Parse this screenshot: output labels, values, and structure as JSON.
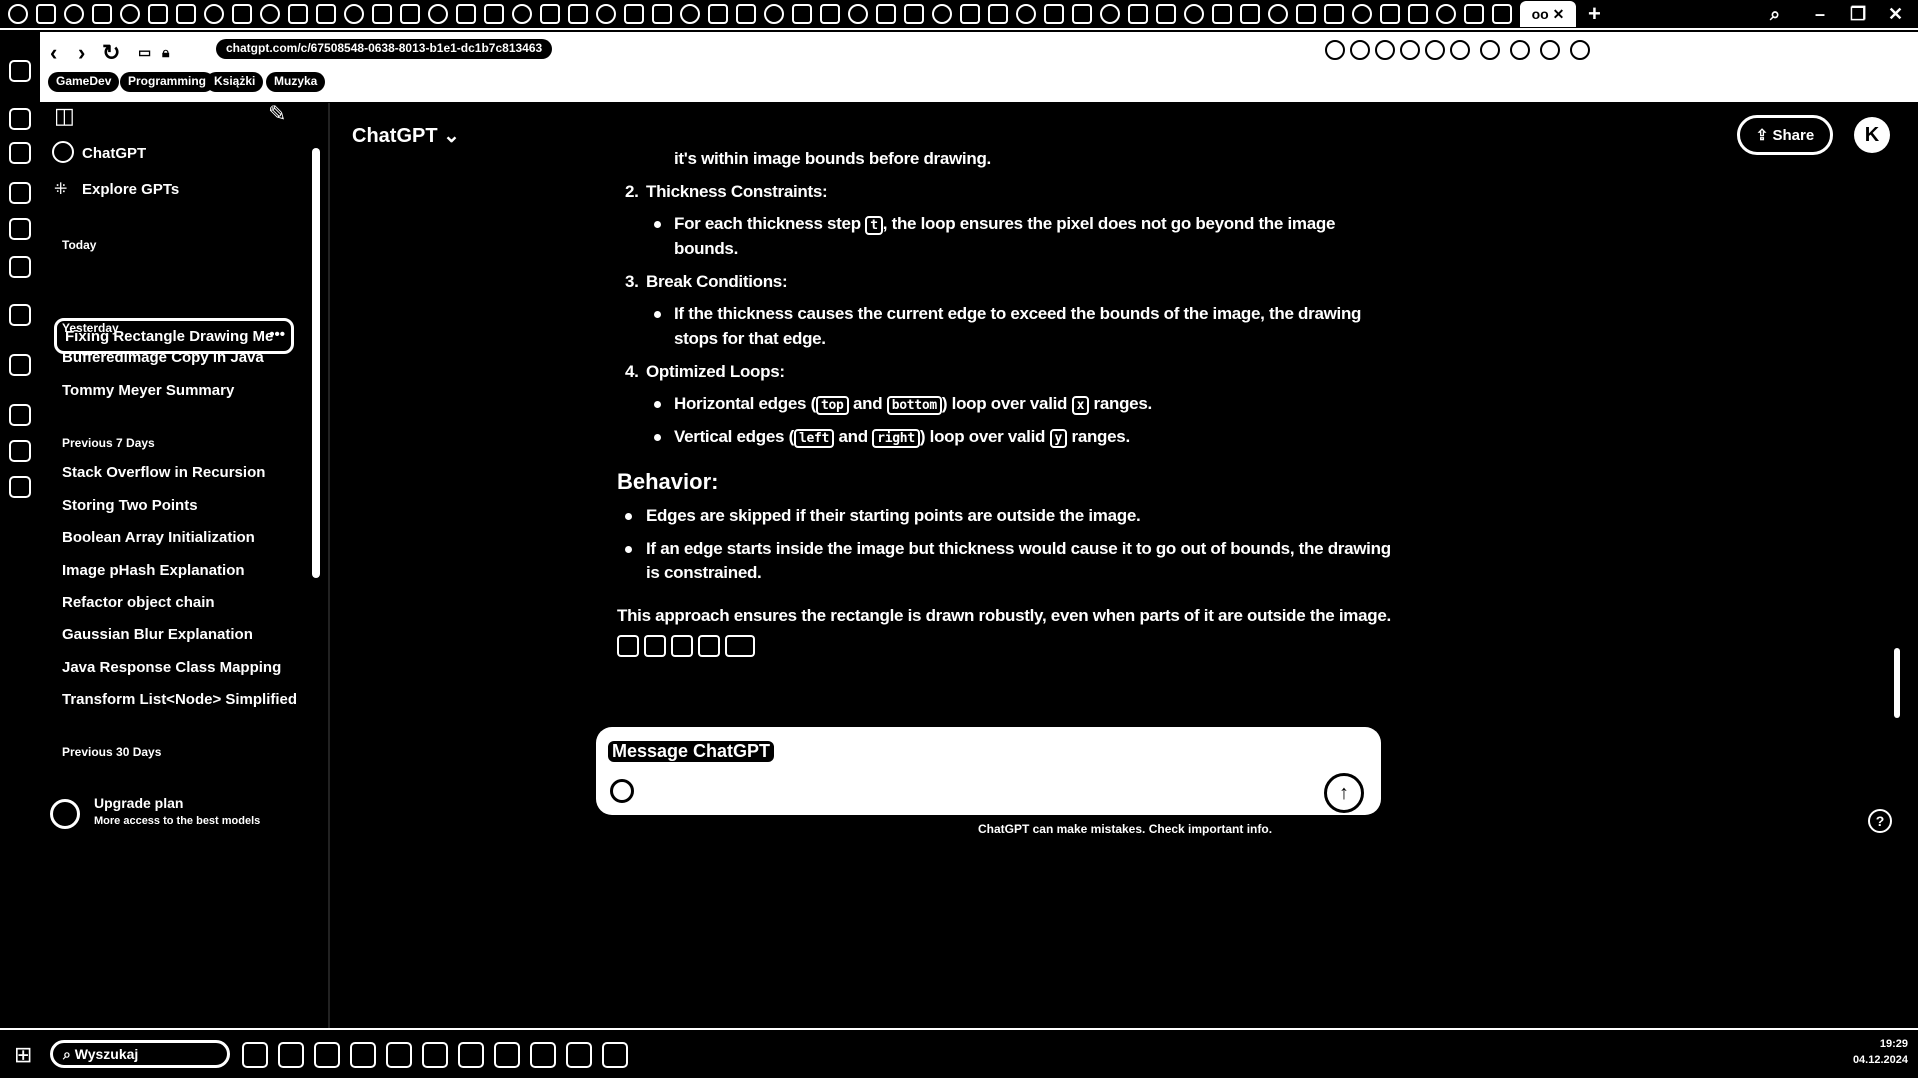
{
  "browser": {
    "active_tab_label": "oo",
    "url": "chatgpt.com/c/67508548-0638-8013-b1e1-dc1b7c813463",
    "bookmarks": [
      "GameDev",
      "Programming",
      "Książki",
      "Muzyka"
    ]
  },
  "sidebar": {
    "items": [
      {
        "label": "ChatGPT"
      },
      {
        "label": "Explore GPTs"
      }
    ],
    "sections": [
      {
        "title": "Today",
        "chats": [
          "Fixing Rectangle Drawing Me"
        ]
      },
      {
        "title": "Yesterday",
        "chats": [
          "BufferedImage Copy in Java",
          "Tommy Meyer Summary"
        ]
      },
      {
        "title": "Previous 7 Days",
        "chats": [
          "Stack Overflow in Recursion",
          "Storing Two Points",
          "Boolean Array Initialization",
          "Image pHash Explanation",
          "Refactor object chain",
          "Gaussian Blur Explanation",
          "Java Response Class Mapping",
          "Transform List<Node> Simplified"
        ]
      },
      {
        "title": "Previous 30 Days",
        "chats": []
      }
    ],
    "upgrade": {
      "title": "Upgrade plan",
      "subtitle": "More access to the best models"
    }
  },
  "header": {
    "model": "ChatGPT",
    "share": "Share",
    "avatar": "K"
  },
  "content": {
    "top_line": "it's within image bounds before drawing.",
    "items": [
      {
        "num": "2.",
        "title": "Thickness Constraints:"
      },
      {
        "num": "3.",
        "title": "Break Conditions:"
      },
      {
        "num": "4.",
        "title": "Optimized Loops:"
      }
    ],
    "b2a": "For each thickness step ",
    "b2code": "t",
    "b2b": ", the loop ensures the pixel does not go beyond the image",
    "b2c": "bounds.",
    "b3a": "If the thickness causes the current edge to exceed the bounds of the image, the drawing",
    "b3b": "stops for that edge.",
    "b4h": {
      "a": "Horizontal edges (",
      "c1": "top",
      "b": " and ",
      "c2": "bottom",
      "c": ") loop over valid ",
      "c3": "x",
      "d": " ranges."
    },
    "b4v": {
      "a": "Vertical edges (",
      "c1": "left",
      "b": " and ",
      "c2": "right",
      "c": ") loop over valid ",
      "c3": "y",
      "d": " ranges."
    },
    "behavior_title": "Behavior:",
    "behavior": [
      "Edges are skipped if their starting points are outside the image.",
      "If an edge starts inside the image but thickness would cause it to go out of bounds, the drawing",
      "is constrained."
    ],
    "summary": "This approach ensures the rectangle is drawn robustly, even when parts of it are outside the image."
  },
  "composer": {
    "placeholder": "Message ChatGPT"
  },
  "footer": {
    "disclaimer": "ChatGPT can make mistakes. Check important info."
  },
  "taskbar": {
    "search": "Wyszukaj",
    "time": "19:29",
    "date": "04.12.2024"
  }
}
